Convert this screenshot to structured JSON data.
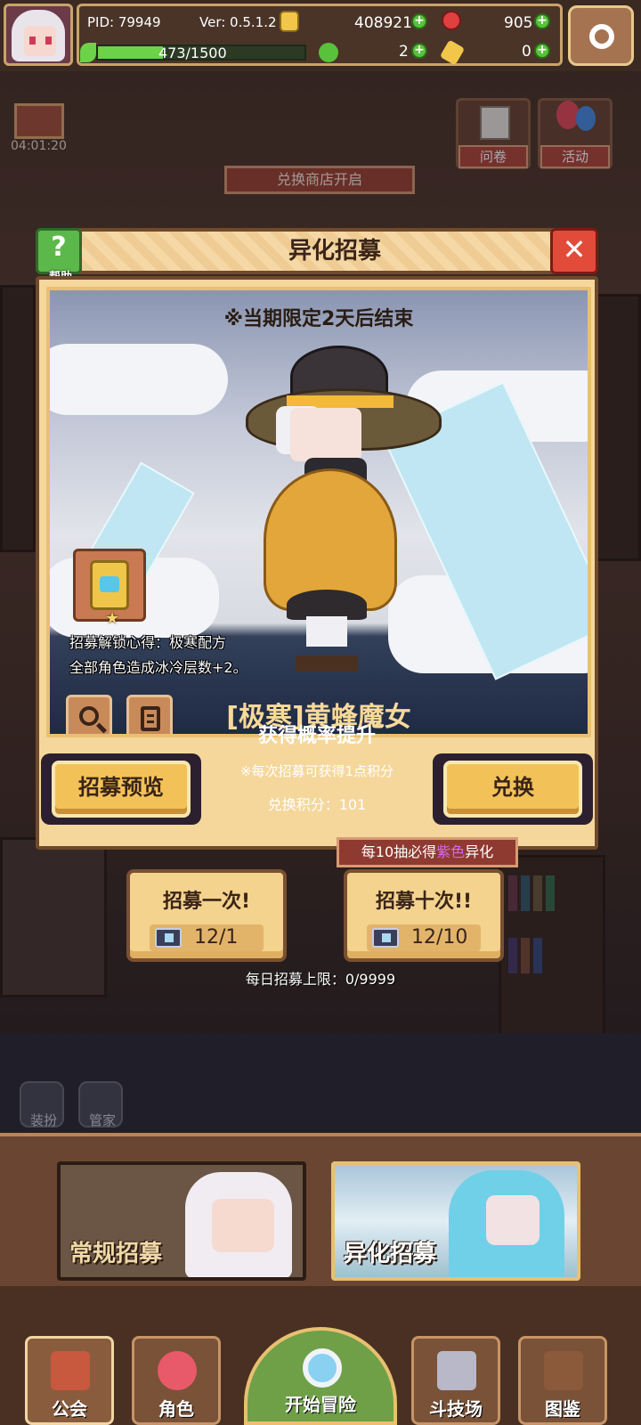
{
  "topbar": {
    "pid_label": "PID: 79949",
    "version_label": "Ver: 0.5.1.2",
    "gold": "408921",
    "gems": "905",
    "energy": "473/1500",
    "energy_fraction": 0.315,
    "clover": "2",
    "key_item": "0",
    "plus_symbol": "+"
  },
  "scene": {
    "timer": "04:01:20",
    "survey_label": "问卷",
    "event_label": "活动",
    "shop_banner": "兑换商店开启",
    "dress_label": "装扮",
    "butler_label": "管家"
  },
  "modal": {
    "title": "异化招募",
    "help_label": "帮助",
    "help_glyph": "?",
    "close_glyph": "✕",
    "limited_notice": "※当期限定2天后结束",
    "unlock_line1": "招募解锁心得：极寒配方",
    "unlock_line2": "全部角色造成冰冷层数+2。",
    "star_glyph": "★",
    "character_name": "[极寒]黄蜂魔女",
    "rate_up": "获得概率提升",
    "points_note": "※每次招募可获得1点积分",
    "points_value": "兑换积分：101",
    "preview_button": "招募预览",
    "exchange_button": "兑换"
  },
  "recruit": {
    "guarantee_prefix": "每10抽必得",
    "guarantee_highlight": "紫色",
    "guarantee_suffix": "异化",
    "single_title": "招募一次!",
    "single_cost": "12/1",
    "ten_title": "招募十次!!",
    "ten_cost": "12/10",
    "daily_limit": "每日招募上限：0/9999"
  },
  "types": {
    "normal": "常规招募",
    "special": "异化招募"
  },
  "nav": {
    "guild": "公会",
    "characters": "角色",
    "adventure": "开始冒险",
    "arena": "斗技场",
    "codex": "图鉴"
  },
  "colors": {
    "accent_gold": "#f2c258",
    "frame_brown": "#6f4a2c",
    "close_red": "#e24a3a",
    "help_green": "#5cb84a",
    "purple_highlight": "#d36af0"
  },
  "icons": {
    "settings": "gear-icon",
    "gold": "coin-icon",
    "gems": "ruby-icon",
    "energy": "leaf-icon",
    "clover": "clover-icon",
    "key_item": "key-icon",
    "search": "magnifier-icon",
    "list": "list-icon",
    "ticket": "heart-ticket-icon"
  }
}
